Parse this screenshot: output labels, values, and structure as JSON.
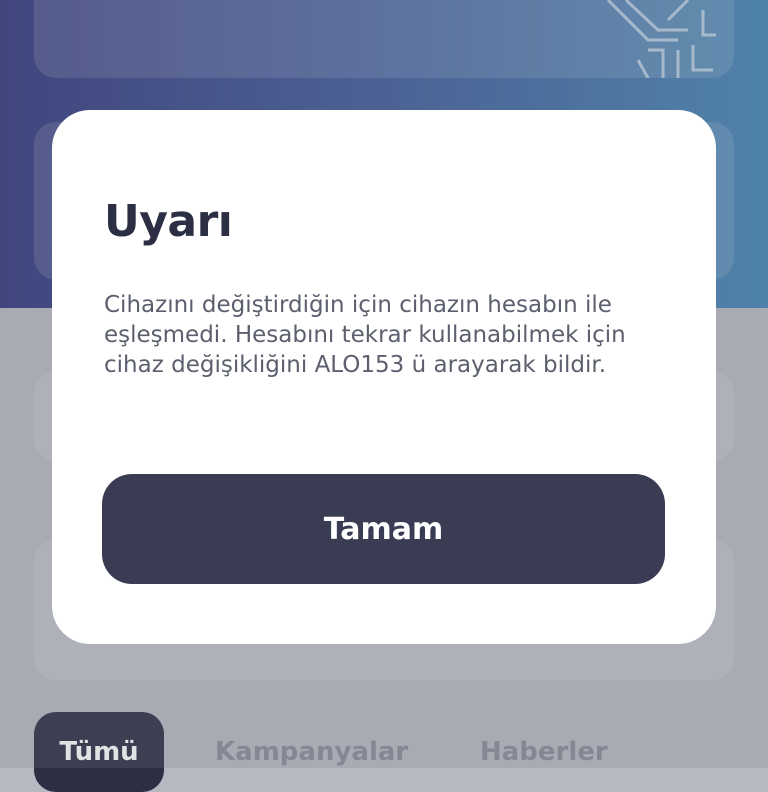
{
  "dialog": {
    "title": "Uyarı",
    "message": "Cihazını değiştirdiğin için cihazın hesabın ile eşleşmedi. Hesabını tekrar kullanabilmek için cihaz değişikliğini ALO153 ü arayarak bildir.",
    "ok_label": "Tamam"
  },
  "tabs": [
    {
      "label": "Tümü",
      "active": true
    },
    {
      "label": "Kampanyalar",
      "active": false
    },
    {
      "label": "Haberler",
      "active": false
    }
  ],
  "colors": {
    "header_gradient_start": "#32387c",
    "header_gradient_end": "#4585b3",
    "dialog_background": "#ffffff",
    "button_background": "#393c52",
    "title_text": "#2c2f44",
    "body_text": "#5c5f6e"
  },
  "icons": {
    "card_icon": "maze-pattern-icon"
  }
}
